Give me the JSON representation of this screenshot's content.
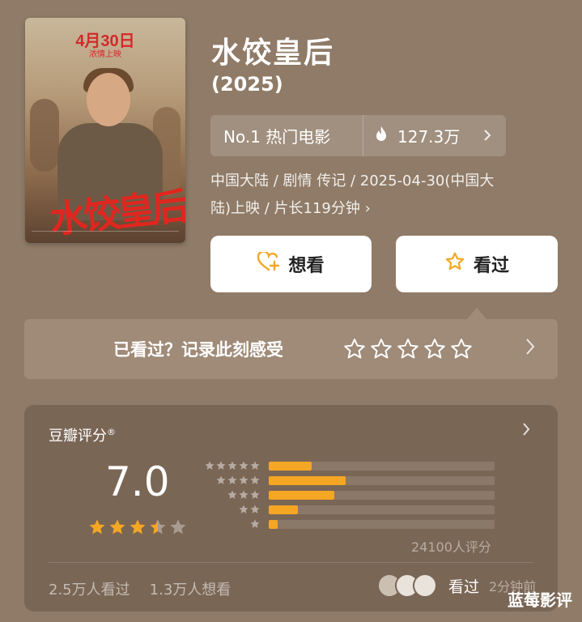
{
  "movie": {
    "poster_date": "4月30日",
    "poster_sub": "浓情上映",
    "poster_calligraphy": "水饺皇后",
    "title": "水饺皇后",
    "year": "(2025)",
    "rank_label": "No.1 热门电影",
    "heat_value": "127.3万",
    "meta_line1": "中国大陆 / 剧情 传记 / 2025-04-30(中国大",
    "meta_line2": "陆)上映 / 片长119分钟 ›"
  },
  "actions": {
    "want_label": "想看",
    "seen_label": "看过"
  },
  "record": {
    "prompt": "已看过？记录此刻感受"
  },
  "rating": {
    "title": "豆瓣评分",
    "registered_mark": "®",
    "score": "7.0",
    "star_fill": 3.5,
    "distribution": [
      {
        "stars": 5,
        "fraction": 0.19
      },
      {
        "stars": 4,
        "fraction": 0.34
      },
      {
        "stars": 3,
        "fraction": 0.29
      },
      {
        "stars": 2,
        "fraction": 0.13
      },
      {
        "stars": 1,
        "fraction": 0.04
      }
    ],
    "count": "24100人评分",
    "seen_count": "2.5万人看过",
    "want_count": "1.3万人想看",
    "friends_label": "看过",
    "friends_time": "2分钟前"
  },
  "watermark": "蓝莓影评",
  "colors": {
    "accent": "#f5a623",
    "background": "#8f7b67",
    "panel": "#7a6655"
  }
}
